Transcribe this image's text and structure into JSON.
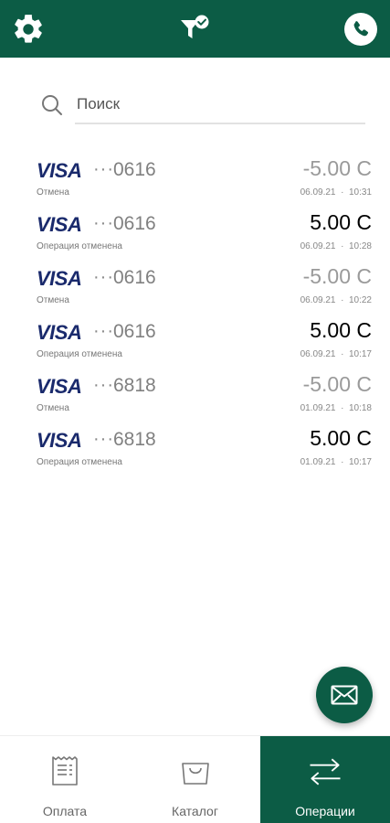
{
  "header": {
    "settings_icon": "gear-icon",
    "filter_icon": "filter-check-icon",
    "phone_icon": "phone-icon",
    "bg_color": "#0c5c45"
  },
  "search": {
    "placeholder": "Поиск"
  },
  "transactions": [
    {
      "brand": "VISA",
      "dots": "···",
      "last4": "0616",
      "status": "Отмена",
      "amount": "-5.00 С",
      "date": "06.09.21",
      "sep": "·",
      "time": "10:31",
      "negative": true
    },
    {
      "brand": "VISA",
      "dots": "···",
      "last4": "0616",
      "status": "Операция отменена",
      "amount": "5.00 С",
      "date": "06.09.21",
      "sep": "·",
      "time": "10:28",
      "negative": false
    },
    {
      "brand": "VISA",
      "dots": "···",
      "last4": "0616",
      "status": "Отмена",
      "amount": "-5.00 С",
      "date": "06.09.21",
      "sep": "·",
      "time": "10:22",
      "negative": true
    },
    {
      "brand": "VISA",
      "dots": "···",
      "last4": "0616",
      "status": "Операция отменена",
      "amount": "5.00 С",
      "date": "06.09.21",
      "sep": "·",
      "time": "10:17",
      "negative": false
    },
    {
      "brand": "VISA",
      "dots": "···",
      "last4": "6818",
      "status": "Отмена",
      "amount": "-5.00 С",
      "date": "01.09.21",
      "sep": "·",
      "time": "10:18",
      "negative": true
    },
    {
      "brand": "VISA",
      "dots": "···",
      "last4": "6818",
      "status": "Операция отменена",
      "amount": "5.00 С",
      "date": "01.09.21",
      "sep": "·",
      "time": "10:17",
      "negative": false
    }
  ],
  "fab": {
    "icon": "mail-icon"
  },
  "bottom_nav": {
    "items": [
      {
        "label": "Оплата",
        "icon": "receipt-icon",
        "active": false
      },
      {
        "label": "Каталог",
        "icon": "shopping-bag-icon",
        "active": false
      },
      {
        "label": "Операции",
        "icon": "transfer-arrows-icon",
        "active": true
      }
    ]
  }
}
